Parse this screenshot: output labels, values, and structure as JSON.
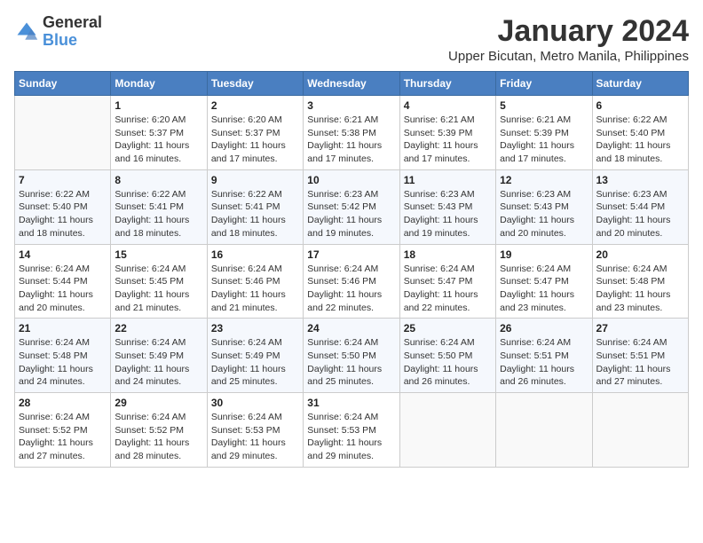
{
  "logo": {
    "general": "General",
    "blue": "Blue"
  },
  "title": "January 2024",
  "location": "Upper Bicutan, Metro Manila, Philippines",
  "days_header": [
    "Sunday",
    "Monday",
    "Tuesday",
    "Wednesday",
    "Thursday",
    "Friday",
    "Saturday"
  ],
  "weeks": [
    [
      {
        "day": "",
        "sunrise": "",
        "sunset": "",
        "daylight": ""
      },
      {
        "day": "1",
        "sunrise": "Sunrise: 6:20 AM",
        "sunset": "Sunset: 5:37 PM",
        "daylight": "Daylight: 11 hours and 16 minutes."
      },
      {
        "day": "2",
        "sunrise": "Sunrise: 6:20 AM",
        "sunset": "Sunset: 5:37 PM",
        "daylight": "Daylight: 11 hours and 17 minutes."
      },
      {
        "day": "3",
        "sunrise": "Sunrise: 6:21 AM",
        "sunset": "Sunset: 5:38 PM",
        "daylight": "Daylight: 11 hours and 17 minutes."
      },
      {
        "day": "4",
        "sunrise": "Sunrise: 6:21 AM",
        "sunset": "Sunset: 5:39 PM",
        "daylight": "Daylight: 11 hours and 17 minutes."
      },
      {
        "day": "5",
        "sunrise": "Sunrise: 6:21 AM",
        "sunset": "Sunset: 5:39 PM",
        "daylight": "Daylight: 11 hours and 17 minutes."
      },
      {
        "day": "6",
        "sunrise": "Sunrise: 6:22 AM",
        "sunset": "Sunset: 5:40 PM",
        "daylight": "Daylight: 11 hours and 18 minutes."
      }
    ],
    [
      {
        "day": "7",
        "sunrise": "Sunrise: 6:22 AM",
        "sunset": "Sunset: 5:40 PM",
        "daylight": "Daylight: 11 hours and 18 minutes."
      },
      {
        "day": "8",
        "sunrise": "Sunrise: 6:22 AM",
        "sunset": "Sunset: 5:41 PM",
        "daylight": "Daylight: 11 hours and 18 minutes."
      },
      {
        "day": "9",
        "sunrise": "Sunrise: 6:22 AM",
        "sunset": "Sunset: 5:41 PM",
        "daylight": "Daylight: 11 hours and 18 minutes."
      },
      {
        "day": "10",
        "sunrise": "Sunrise: 6:23 AM",
        "sunset": "Sunset: 5:42 PM",
        "daylight": "Daylight: 11 hours and 19 minutes."
      },
      {
        "day": "11",
        "sunrise": "Sunrise: 6:23 AM",
        "sunset": "Sunset: 5:43 PM",
        "daylight": "Daylight: 11 hours and 19 minutes."
      },
      {
        "day": "12",
        "sunrise": "Sunrise: 6:23 AM",
        "sunset": "Sunset: 5:43 PM",
        "daylight": "Daylight: 11 hours and 20 minutes."
      },
      {
        "day": "13",
        "sunrise": "Sunrise: 6:23 AM",
        "sunset": "Sunset: 5:44 PM",
        "daylight": "Daylight: 11 hours and 20 minutes."
      }
    ],
    [
      {
        "day": "14",
        "sunrise": "Sunrise: 6:24 AM",
        "sunset": "Sunset: 5:44 PM",
        "daylight": "Daylight: 11 hours and 20 minutes."
      },
      {
        "day": "15",
        "sunrise": "Sunrise: 6:24 AM",
        "sunset": "Sunset: 5:45 PM",
        "daylight": "Daylight: 11 hours and 21 minutes."
      },
      {
        "day": "16",
        "sunrise": "Sunrise: 6:24 AM",
        "sunset": "Sunset: 5:46 PM",
        "daylight": "Daylight: 11 hours and 21 minutes."
      },
      {
        "day": "17",
        "sunrise": "Sunrise: 6:24 AM",
        "sunset": "Sunset: 5:46 PM",
        "daylight": "Daylight: 11 hours and 22 minutes."
      },
      {
        "day": "18",
        "sunrise": "Sunrise: 6:24 AM",
        "sunset": "Sunset: 5:47 PM",
        "daylight": "Daylight: 11 hours and 22 minutes."
      },
      {
        "day": "19",
        "sunrise": "Sunrise: 6:24 AM",
        "sunset": "Sunset: 5:47 PM",
        "daylight": "Daylight: 11 hours and 23 minutes."
      },
      {
        "day": "20",
        "sunrise": "Sunrise: 6:24 AM",
        "sunset": "Sunset: 5:48 PM",
        "daylight": "Daylight: 11 hours and 23 minutes."
      }
    ],
    [
      {
        "day": "21",
        "sunrise": "Sunrise: 6:24 AM",
        "sunset": "Sunset: 5:48 PM",
        "daylight": "Daylight: 11 hours and 24 minutes."
      },
      {
        "day": "22",
        "sunrise": "Sunrise: 6:24 AM",
        "sunset": "Sunset: 5:49 PM",
        "daylight": "Daylight: 11 hours and 24 minutes."
      },
      {
        "day": "23",
        "sunrise": "Sunrise: 6:24 AM",
        "sunset": "Sunset: 5:49 PM",
        "daylight": "Daylight: 11 hours and 25 minutes."
      },
      {
        "day": "24",
        "sunrise": "Sunrise: 6:24 AM",
        "sunset": "Sunset: 5:50 PM",
        "daylight": "Daylight: 11 hours and 25 minutes."
      },
      {
        "day": "25",
        "sunrise": "Sunrise: 6:24 AM",
        "sunset": "Sunset: 5:50 PM",
        "daylight": "Daylight: 11 hours and 26 minutes."
      },
      {
        "day": "26",
        "sunrise": "Sunrise: 6:24 AM",
        "sunset": "Sunset: 5:51 PM",
        "daylight": "Daylight: 11 hours and 26 minutes."
      },
      {
        "day": "27",
        "sunrise": "Sunrise: 6:24 AM",
        "sunset": "Sunset: 5:51 PM",
        "daylight": "Daylight: 11 hours and 27 minutes."
      }
    ],
    [
      {
        "day": "28",
        "sunrise": "Sunrise: 6:24 AM",
        "sunset": "Sunset: 5:52 PM",
        "daylight": "Daylight: 11 hours and 27 minutes."
      },
      {
        "day": "29",
        "sunrise": "Sunrise: 6:24 AM",
        "sunset": "Sunset: 5:52 PM",
        "daylight": "Daylight: 11 hours and 28 minutes."
      },
      {
        "day": "30",
        "sunrise": "Sunrise: 6:24 AM",
        "sunset": "Sunset: 5:53 PM",
        "daylight": "Daylight: 11 hours and 29 minutes."
      },
      {
        "day": "31",
        "sunrise": "Sunrise: 6:24 AM",
        "sunset": "Sunset: 5:53 PM",
        "daylight": "Daylight: 11 hours and 29 minutes."
      },
      {
        "day": "",
        "sunrise": "",
        "sunset": "",
        "daylight": ""
      },
      {
        "day": "",
        "sunrise": "",
        "sunset": "",
        "daylight": ""
      },
      {
        "day": "",
        "sunrise": "",
        "sunset": "",
        "daylight": ""
      }
    ]
  ]
}
